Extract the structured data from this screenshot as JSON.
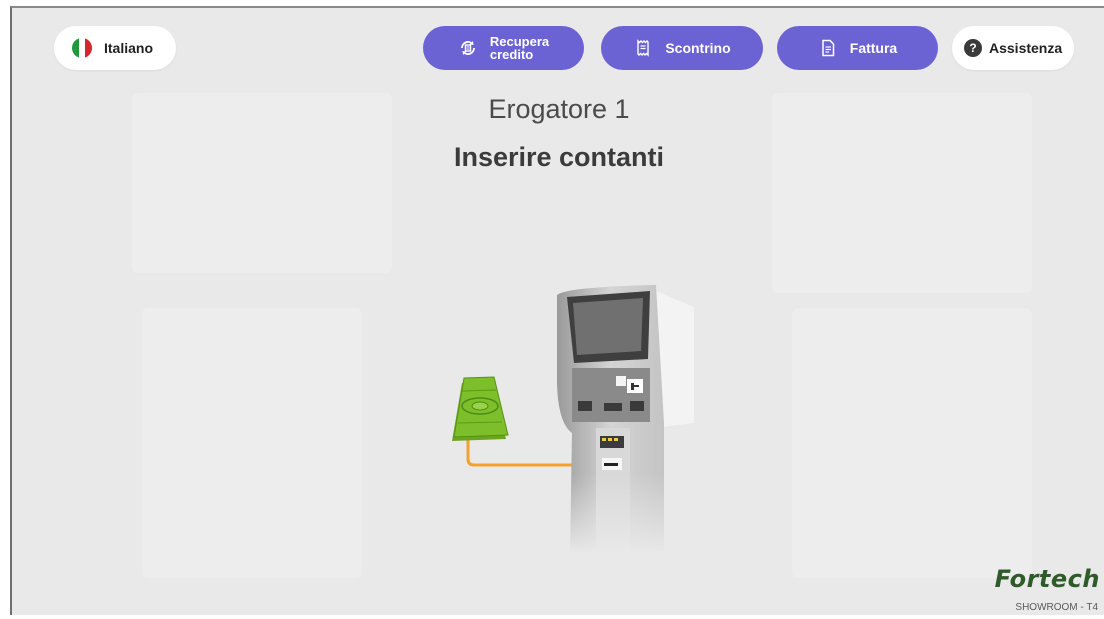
{
  "header": {
    "language": {
      "label": "Italiano",
      "icon": "italy-flag-icon",
      "flag_colors": [
        "#1e9a3a",
        "#ffffff",
        "#d62828"
      ]
    },
    "actions": [
      {
        "id": "recupera",
        "label_line1": "Recupera",
        "label_line2": "credito",
        "icon": "recover-credit-icon"
      },
      {
        "id": "scontrino",
        "label": "Scontrino",
        "icon": "receipt-icon"
      },
      {
        "id": "fattura",
        "label": "Fattura",
        "icon": "invoice-icon"
      }
    ],
    "help": {
      "label": "Assistenza",
      "icon": "question-icon",
      "symbol": "?"
    }
  },
  "main": {
    "title": "Erogatore 1",
    "instruction": "Inserire contanti",
    "illustration": "insert-cash-kiosk-illustration"
  },
  "footer": {
    "brand": "Fortech",
    "location": "SHOWROOM - T4"
  },
  "colors": {
    "accent": "#6b63d4",
    "background": "#e9e9e9",
    "banknote": "#7cbf2a",
    "guide_line": "#f2a12e"
  }
}
